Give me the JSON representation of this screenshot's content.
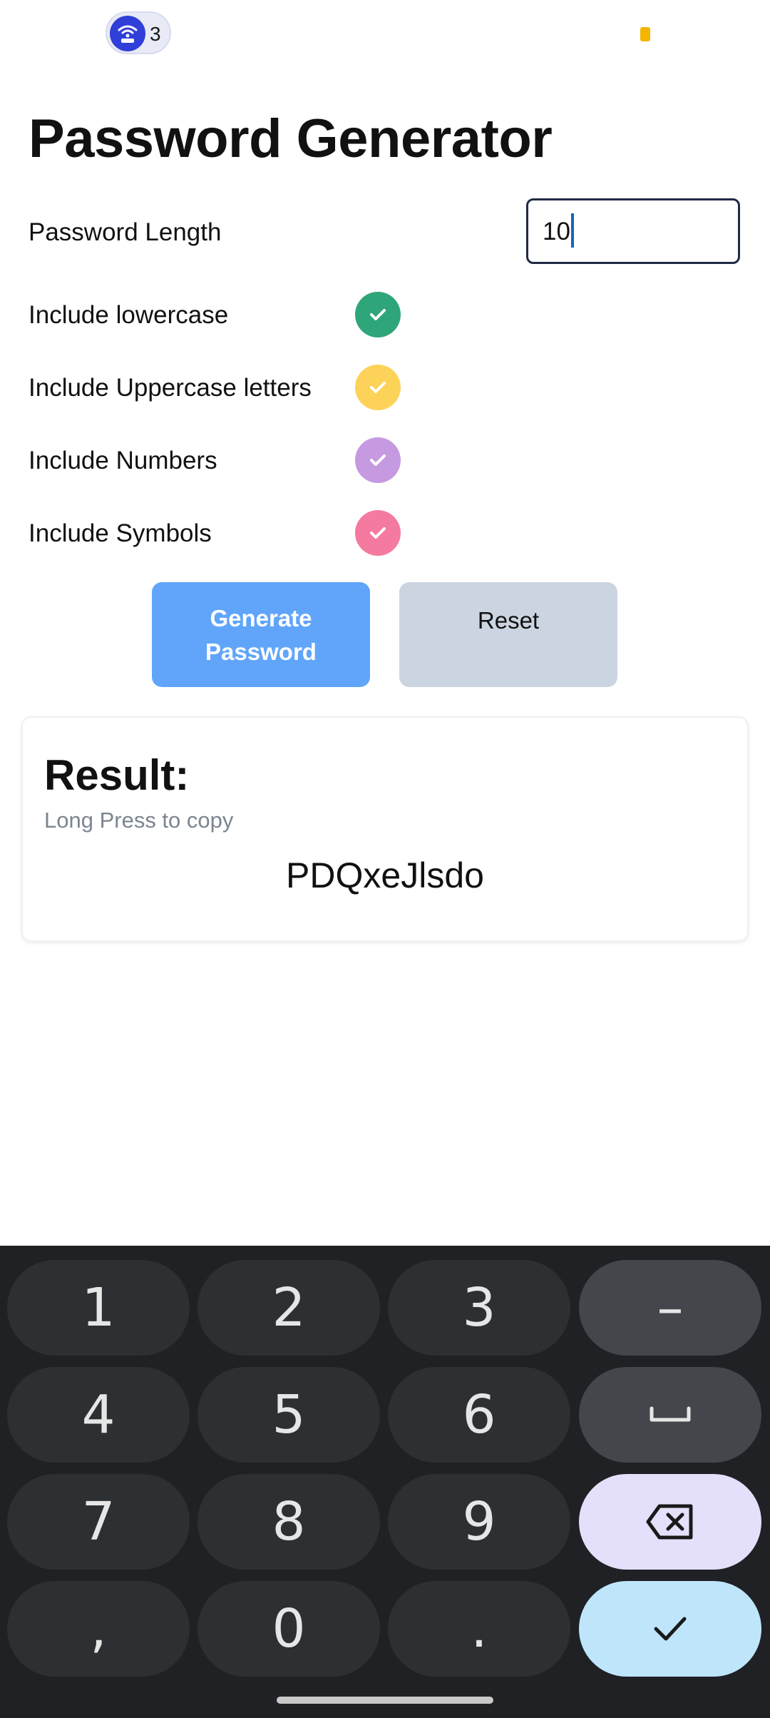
{
  "status_bar": {
    "hotspot_icon": "wifi-hotspot-icon",
    "hotspot_count": "3",
    "accent": "#2f3fd8",
    "indicator_color": "#f4b400"
  },
  "title": "Password Generator",
  "password_length": {
    "label": "Password Length",
    "value": "10"
  },
  "options": [
    {
      "label": "Include lowercase",
      "checked": true,
      "color": "#2fa57a"
    },
    {
      "label": "Include Uppercase letters",
      "checked": true,
      "color": "#fcd358"
    },
    {
      "label": "Include Numbers",
      "checked": true,
      "color": "#c59ae0"
    },
    {
      "label": "Include Symbols",
      "checked": true,
      "color": "#f47aa0"
    }
  ],
  "buttons": {
    "generate": "Generate Password",
    "reset": "Reset",
    "generate_color": "#60a5fa",
    "reset_color": "#cbd5e1"
  },
  "result": {
    "title": "Result:",
    "hint": "Long Press to copy",
    "password": "PDQxeJlsdo"
  },
  "keyboard": {
    "rows": [
      [
        "1",
        "2",
        "3",
        "–"
      ],
      [
        "4",
        "5",
        "6",
        "␣"
      ],
      [
        "7",
        "8",
        "9",
        "⌫"
      ],
      [
        ",",
        "0",
        ".",
        "✓"
      ]
    ],
    "space_icon": "space-icon",
    "backspace_icon": "backspace-icon",
    "done_icon": "checkmark-icon"
  }
}
